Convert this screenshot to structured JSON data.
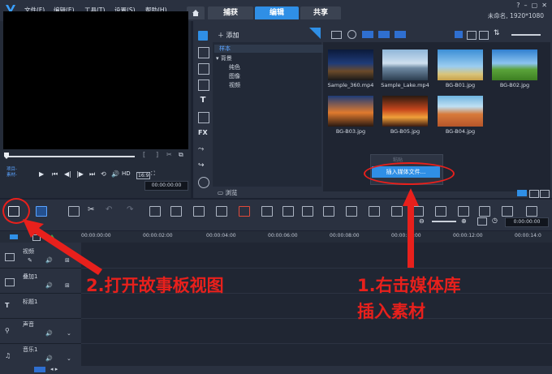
{
  "window": {
    "menu": [
      "文件(F)",
      "编辑(E)",
      "工具(T)",
      "设置(S)",
      "帮助(H)"
    ],
    "tabs": {
      "capture": "捕获",
      "edit": "编辑",
      "share": "共享"
    },
    "project_info": "未命名, 1920*1080"
  },
  "player": {
    "mode_project": "项目-",
    "mode_clip": "素材-",
    "hd_label": "HD",
    "timecode": "00:00:00:00"
  },
  "library": {
    "add_label": "添加",
    "tree": [
      "样本",
      "背景",
      "纯色",
      "图像",
      "视频"
    ],
    "browse_label": "浏览",
    "items": [
      {
        "name": "Sample_360.mp4"
      },
      {
        "name": "Sample_Lake.mp4"
      },
      {
        "name": "BG-B01.jpg"
      },
      {
        "name": "BG-B02.jpg"
      },
      {
        "name": "BG-B03.jpg"
      },
      {
        "name": "BG-B05.jpg"
      },
      {
        "name": "BG-B04.jpg"
      }
    ],
    "context_menu": {
      "disabled_item": "粘贴",
      "insert_media": "插入媒体文件..."
    }
  },
  "timeline": {
    "timecode": "0:00:00:00",
    "ruler": [
      "00:00:00:00",
      "00:00:02:00",
      "00:00:04:00",
      "00:00:06:00",
      "00:00:08:00",
      "00:00:10:00",
      "00:00:12:00",
      "00:00:14:0"
    ],
    "tracks": [
      "视频",
      "叠加1",
      "标题1",
      "声音",
      "音乐1"
    ]
  },
  "annotations": {
    "step1_line1": "1.右击媒体库",
    "step1_line2": "插入素材",
    "step2": "2.打开故事板视图"
  },
  "colors": {
    "accent": "#2f8fe6",
    "annotation_red": "#e8201c"
  }
}
